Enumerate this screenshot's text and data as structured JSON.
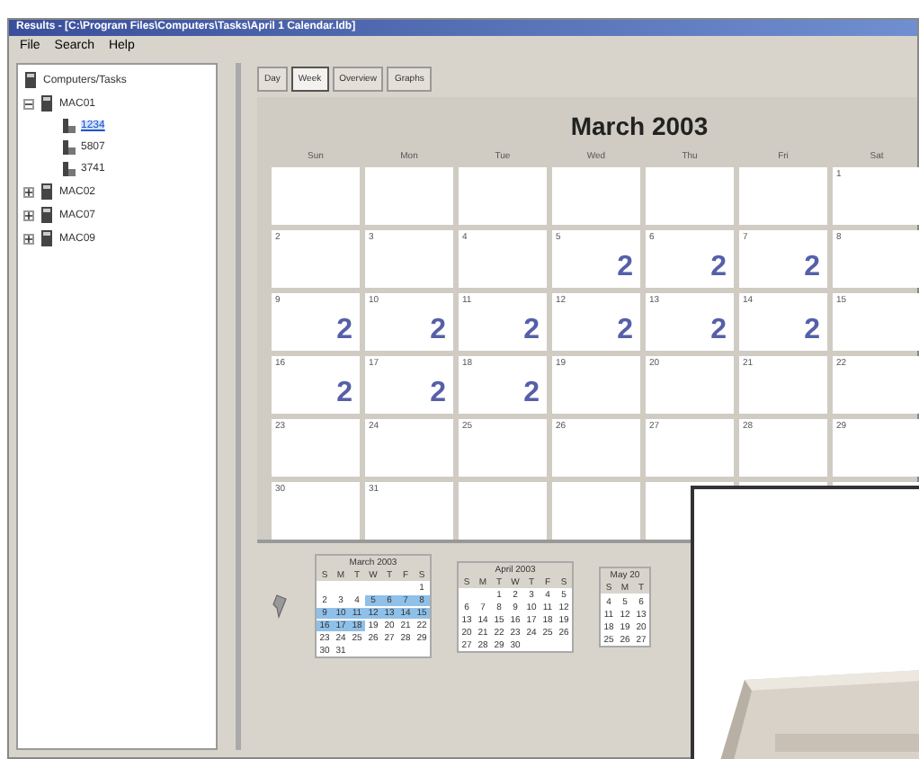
{
  "window": {
    "title": "Results - [C:\\Program Files\\Computers\\Tasks\\April 1 Calendar.ldb]"
  },
  "menu": [
    "File",
    "Search",
    "Help"
  ],
  "tree": {
    "label": "Computers/Tasks",
    "items": [
      {
        "label": "MAC01",
        "expanded": true,
        "children": [
          {
            "label": "1234",
            "selected": true
          },
          {
            "label": "5807",
            "selected": false
          },
          {
            "label": "3741",
            "selected": false
          }
        ]
      },
      {
        "label": "MAC02",
        "expanded": false
      },
      {
        "label": "MAC07",
        "expanded": false
      },
      {
        "label": "MAC09",
        "expanded": false
      }
    ]
  },
  "tabs": [
    {
      "label": "Day",
      "selected": false
    },
    {
      "label": "Week",
      "selected": true
    },
    {
      "label": "Overview",
      "selected": false
    },
    {
      "label": "Graphs",
      "selected": false
    }
  ],
  "calendar": {
    "title": "March 2003",
    "weekdays": [
      "Sun",
      "Mon",
      "Tue",
      "Wed",
      "Thu",
      "Fri",
      "Sat"
    ],
    "weeks": [
      [
        {
          "kind": "blank"
        },
        {
          "kind": "blank"
        },
        {
          "kind": "blank"
        },
        {
          "kind": "blank"
        },
        {
          "kind": "blank"
        },
        {
          "kind": "blank"
        },
        {
          "kind": "day",
          "day": "1"
        }
      ],
      [
        {
          "kind": "day",
          "day": "2"
        },
        {
          "kind": "day",
          "day": "3"
        },
        {
          "kind": "day",
          "day": "4"
        },
        {
          "kind": "day",
          "day": "5",
          "count": "2"
        },
        {
          "kind": "day",
          "day": "6",
          "count": "2"
        },
        {
          "kind": "day",
          "day": "7",
          "count": "2"
        },
        {
          "kind": "day",
          "day": "8"
        }
      ],
      [
        {
          "kind": "day",
          "day": "9",
          "count": "2"
        },
        {
          "kind": "day",
          "day": "10",
          "count": "2"
        },
        {
          "kind": "day",
          "day": "11",
          "count": "2"
        },
        {
          "kind": "day",
          "day": "12",
          "count": "2"
        },
        {
          "kind": "day",
          "day": "13",
          "count": "2"
        },
        {
          "kind": "day",
          "day": "14",
          "count": "2"
        },
        {
          "kind": "day",
          "day": "15"
        }
      ],
      [
        {
          "kind": "day",
          "day": "16",
          "count": "2"
        },
        {
          "kind": "day",
          "day": "17",
          "count": "2"
        },
        {
          "kind": "day",
          "day": "18",
          "count": "2"
        },
        {
          "kind": "day",
          "day": "19"
        },
        {
          "kind": "day",
          "day": "20"
        },
        {
          "kind": "day",
          "day": "21"
        },
        {
          "kind": "day",
          "day": "22"
        }
      ],
      [
        {
          "kind": "day",
          "day": "23"
        },
        {
          "kind": "day",
          "day": "24"
        },
        {
          "kind": "day",
          "day": "25"
        },
        {
          "kind": "day",
          "day": "26"
        },
        {
          "kind": "day",
          "day": "27"
        },
        {
          "kind": "day",
          "day": "28"
        },
        {
          "kind": "day",
          "day": "29"
        }
      ],
      [
        {
          "kind": "day",
          "day": "30"
        },
        {
          "kind": "day",
          "day": "31"
        },
        {
          "kind": "blank"
        },
        {
          "kind": "blank"
        }
      ]
    ]
  },
  "mini_calendars": [
    {
      "title": "March 2003",
      "weekdays": [
        "S",
        "M",
        "T",
        "W",
        "T",
        "F",
        "S"
      ],
      "weeks": [
        [
          {
            "kind": "blank"
          },
          {
            "kind": "blank"
          },
          {
            "kind": "blank"
          },
          {
            "kind": "blank"
          },
          {
            "kind": "blank"
          },
          {
            "kind": "blank"
          },
          {
            "kind": "day",
            "day": "1",
            "selected": false
          }
        ],
        [
          {
            "kind": "day",
            "day": "2",
            "selected": false
          },
          {
            "kind": "day",
            "day": "3",
            "selected": false
          },
          {
            "kind": "day",
            "day": "4",
            "selected": false
          },
          {
            "kind": "day",
            "day": "5",
            "selected": true
          },
          {
            "kind": "day",
            "day": "6",
            "selected": true
          },
          {
            "kind": "day",
            "day": "7",
            "selected": true
          },
          {
            "kind": "day",
            "day": "8",
            "selected": true
          }
        ],
        [
          {
            "kind": "day",
            "day": "9",
            "selected": true
          },
          {
            "kind": "day",
            "day": "10",
            "selected": true
          },
          {
            "kind": "day",
            "day": "11",
            "selected": true
          },
          {
            "kind": "day",
            "day": "12",
            "selected": true
          },
          {
            "kind": "day",
            "day": "13",
            "selected": true
          },
          {
            "kind": "day",
            "day": "14",
            "selected": true
          },
          {
            "kind": "day",
            "day": "15",
            "selected": true
          }
        ],
        [
          {
            "kind": "day",
            "day": "16",
            "selected": true
          },
          {
            "kind": "day",
            "day": "17",
            "selected": true
          },
          {
            "kind": "day",
            "day": "18",
            "selected": true
          },
          {
            "kind": "day",
            "day": "19",
            "selected": false
          },
          {
            "kind": "day",
            "day": "20",
            "selected": false
          },
          {
            "kind": "day",
            "day": "21",
            "selected": false
          },
          {
            "kind": "day",
            "day": "22",
            "selected": false
          }
        ],
        [
          {
            "kind": "day",
            "day": "23",
            "selected": false
          },
          {
            "kind": "day",
            "day": "24",
            "selected": false
          },
          {
            "kind": "day",
            "day": "25",
            "selected": false
          },
          {
            "kind": "day",
            "day": "26",
            "selected": false
          },
          {
            "kind": "day",
            "day": "27",
            "selected": false
          },
          {
            "kind": "day",
            "day": "28",
            "selected": false
          },
          {
            "kind": "day",
            "day": "29",
            "selected": false
          }
        ],
        [
          {
            "kind": "day",
            "day": "30",
            "selected": false
          },
          {
            "kind": "day",
            "day": "31",
            "selected": false
          }
        ]
      ]
    },
    {
      "title": "April 2003",
      "weekdays": [
        "S",
        "M",
        "T",
        "W",
        "T",
        "F",
        "S"
      ],
      "weeks": [
        [
          {
            "kind": "blank"
          },
          {
            "kind": "blank"
          },
          {
            "kind": "day",
            "day": "1",
            "selected": false
          },
          {
            "kind": "day",
            "day": "2",
            "selected": false
          },
          {
            "kind": "day",
            "day": "3",
            "selected": false
          },
          {
            "kind": "day",
            "day": "4",
            "selected": false
          },
          {
            "kind": "day",
            "day": "5",
            "selected": false
          }
        ],
        [
          {
            "kind": "day",
            "day": "6",
            "selected": false
          },
          {
            "kind": "day",
            "day": "7",
            "selected": false
          },
          {
            "kind": "day",
            "day": "8",
            "selected": false
          },
          {
            "kind": "day",
            "day": "9",
            "selected": false
          },
          {
            "kind": "day",
            "day": "10",
            "selected": false
          },
          {
            "kind": "day",
            "day": "11",
            "selected": false
          },
          {
            "kind": "day",
            "day": "12",
            "selected": false
          }
        ],
        [
          {
            "kind": "day",
            "day": "13",
            "selected": false
          },
          {
            "kind": "day",
            "day": "14",
            "selected": false
          },
          {
            "kind": "day",
            "day": "15",
            "selected": false
          },
          {
            "kind": "day",
            "day": "16",
            "selected": false
          },
          {
            "kind": "day",
            "day": "17",
            "selected": false
          },
          {
            "kind": "day",
            "day": "18",
            "selected": false
          },
          {
            "kind": "day",
            "day": "19",
            "selected": false
          }
        ],
        [
          {
            "kind": "day",
            "day": "20",
            "selected": false
          },
          {
            "kind": "day",
            "day": "21",
            "selected": false
          },
          {
            "kind": "day",
            "day": "22",
            "selected": false
          },
          {
            "kind": "day",
            "day": "23",
            "selected": false
          },
          {
            "kind": "day",
            "day": "24",
            "selected": false
          },
          {
            "kind": "day",
            "day": "25",
            "selected": false
          },
          {
            "kind": "day",
            "day": "26",
            "selected": false
          }
        ],
        [
          {
            "kind": "day",
            "day": "27",
            "selected": false
          },
          {
            "kind": "day",
            "day": "28",
            "selected": false
          },
          {
            "kind": "day",
            "day": "29",
            "selected": false
          },
          {
            "kind": "day",
            "day": "30",
            "selected": false
          }
        ]
      ]
    },
    {
      "title": "May 20",
      "weekdays": [
        "S",
        "M",
        "T"
      ],
      "weeks": [
        [
          {
            "kind": "blank"
          },
          {
            "kind": "blank"
          },
          {
            "kind": "blank"
          }
        ],
        [
          {
            "kind": "day",
            "day": "4",
            "selected": false
          },
          {
            "kind": "day",
            "day": "5",
            "selected": false
          },
          {
            "kind": "day",
            "day": "6",
            "selected": false
          }
        ],
        [
          {
            "kind": "day",
            "day": "11",
            "selected": false
          },
          {
            "kind": "day",
            "day": "12",
            "selected": false
          },
          {
            "kind": "day",
            "day": "13",
            "selected": false
          }
        ],
        [
          {
            "kind": "day",
            "day": "18",
            "selected": false
          },
          {
            "kind": "day",
            "day": "19",
            "selected": false
          },
          {
            "kind": "day",
            "day": "20",
            "selected": false
          }
        ],
        [
          {
            "kind": "day",
            "day": "25",
            "selected": false
          },
          {
            "kind": "day",
            "day": "26",
            "selected": false
          },
          {
            "kind": "day",
            "day": "27",
            "selected": false
          }
        ]
      ]
    }
  ],
  "overlay": {
    "kind": "picture"
  }
}
